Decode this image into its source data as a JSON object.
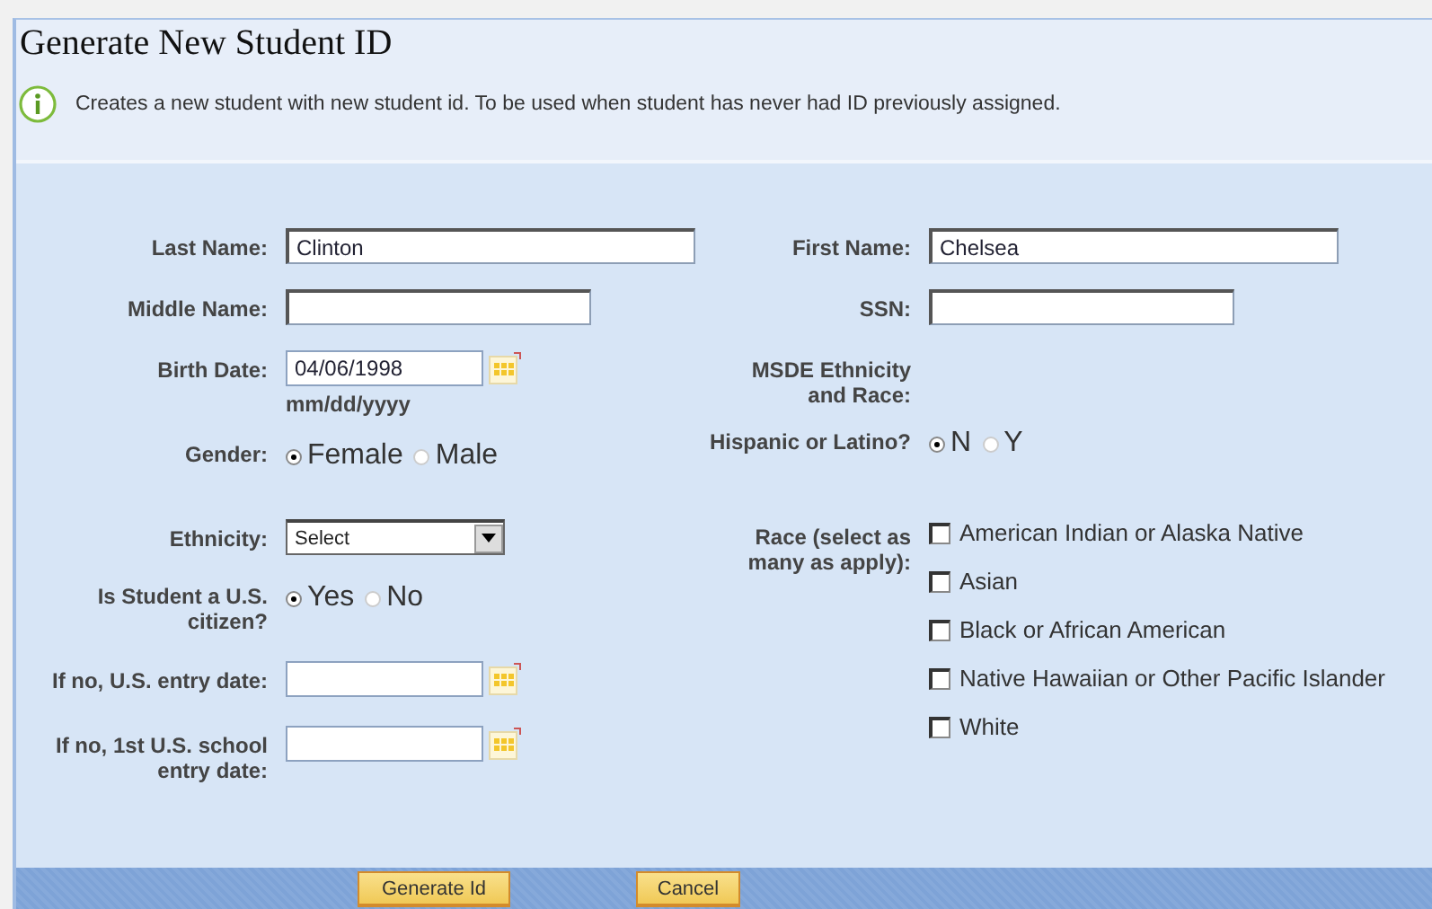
{
  "title": "Generate New Student ID",
  "info": "Creates a new student with new student id. To be used when student has never had ID previously assigned.",
  "left_fields": [
    {
      "kind": "text",
      "label": "Last Name:",
      "value": "Clinton"
    },
    {
      "kind": "text",
      "label": "Middle Name:"
    },
    {
      "kind": "date",
      "label": "Birth Date:",
      "value": "04/06/1998",
      "hint": "mm/dd/yyyy"
    },
    {
      "kind": "radio",
      "label": "Gender:",
      "options": [
        {
          "label": "Female",
          "selected": true
        },
        {
          "label": "Male",
          "selected": false
        }
      ]
    },
    {
      "kind": "select",
      "label": "Ethnicity:",
      "value": "Select"
    },
    {
      "kind": "radio",
      "label": "Is Student a U.S. citizen?",
      "options": [
        {
          "label": "Yes",
          "selected": true
        },
        {
          "label": "No",
          "selected": false
        }
      ]
    },
    {
      "kind": "date",
      "label": "If no, U.S. entry date:"
    },
    {
      "kind": "date",
      "label": "If no,  1st U.S. school entry date:"
    }
  ],
  "right_fields": [
    {
      "kind": "text",
      "label": "First Name:",
      "value": "Chelsea"
    },
    {
      "kind": "text",
      "label": "SSN:"
    },
    {
      "kind": "heading",
      "label": "MSDE Ethnicity and Race:"
    },
    {
      "kind": "radio",
      "label": "Hispanic or Latino?",
      "options": [
        {
          "label": "N",
          "selected": true
        },
        {
          "label": "Y",
          "selected": false
        }
      ]
    },
    {
      "kind": "checklist",
      "label": "Race (select as many as apply):",
      "options": [
        {
          "label": "American Indian or Alaska Native",
          "checked": false
        },
        {
          "label": "Asian",
          "checked": false
        },
        {
          "label": "Black or African American",
          "checked": false
        },
        {
          "label": "Native Hawaiian or Other Pacific Islander",
          "checked": false
        },
        {
          "label": "White",
          "checked": false
        }
      ]
    }
  ],
  "buttons": [
    "Generate Id",
    "Cancel"
  ]
}
